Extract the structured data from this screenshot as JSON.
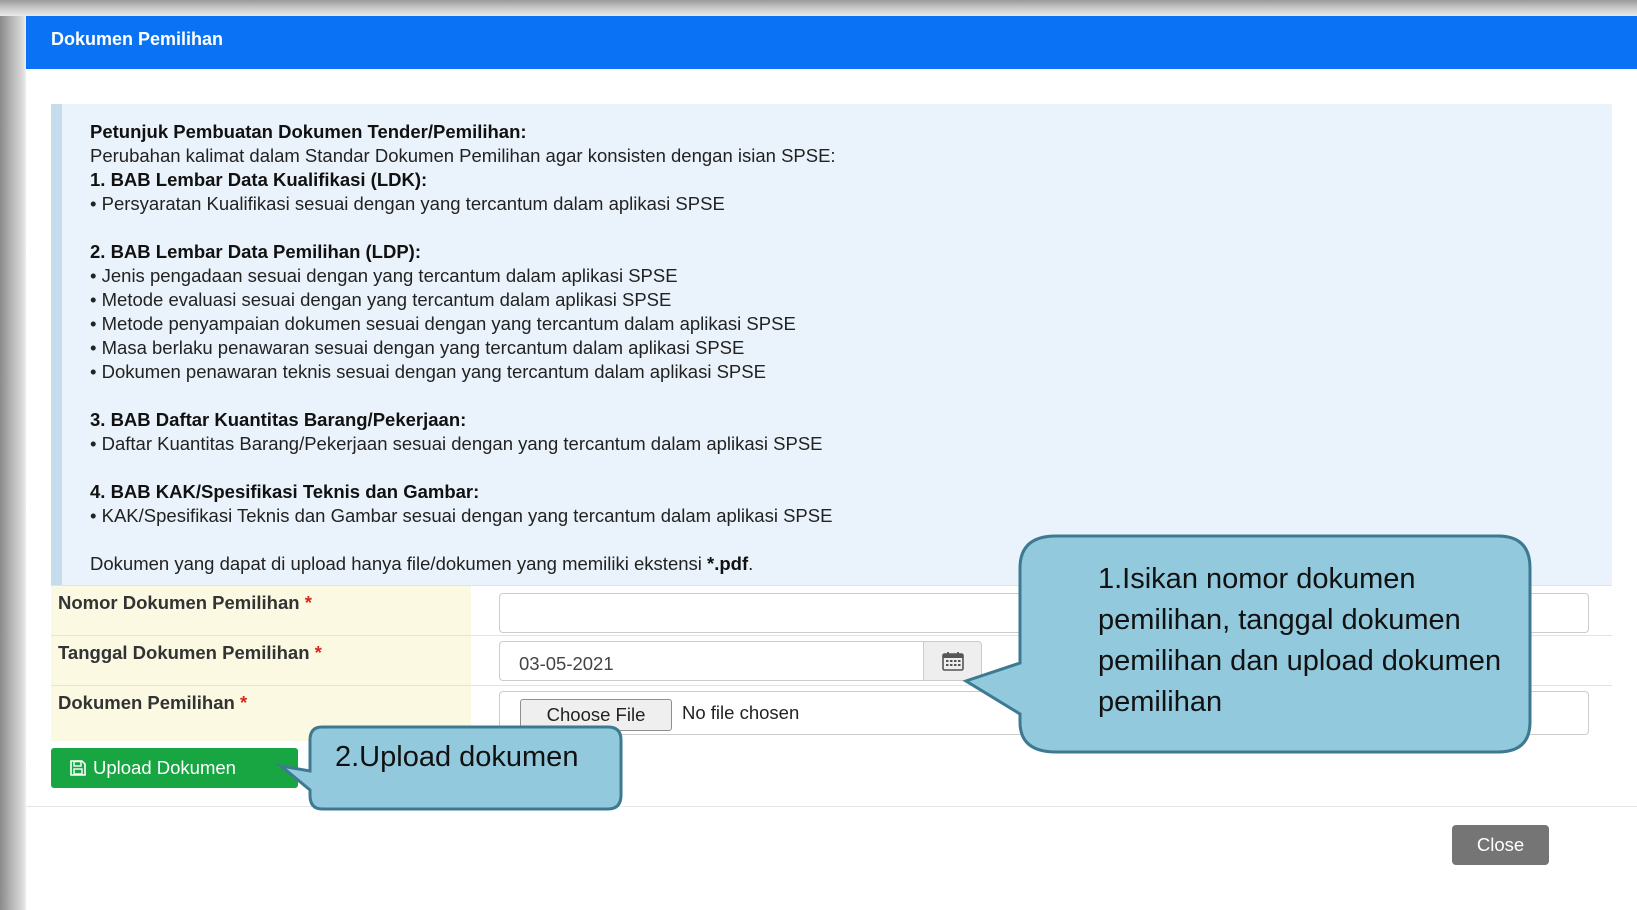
{
  "dialog": {
    "title": "Dokumen Pemilihan"
  },
  "instructions": {
    "heading": "Petunjuk Pembuatan Dokumen Tender/Pemilihan:",
    "intro": "Perubahan kalimat dalam Standar Dokumen Pemilihan agar konsisten dengan isian SPSE:",
    "sections": [
      {
        "title": "1. BAB Lembar Data Kualifikasi (LDK):",
        "items": [
          "• Persyaratan Kualifikasi sesuai dengan yang tercantum dalam aplikasi SPSE"
        ]
      },
      {
        "title": "2. BAB Lembar Data Pemilihan (LDP):",
        "items": [
          "• Jenis pengadaan sesuai dengan yang tercantum dalam aplikasi SPSE",
          "• Metode evaluasi sesuai dengan yang tercantum dalam aplikasi SPSE",
          "• Metode penyampaian dokumen sesuai dengan yang tercantum dalam aplikasi SPSE",
          "• Masa berlaku penawaran sesuai dengan yang tercantum dalam aplikasi SPSE",
          "• Dokumen penawaran teknis sesuai dengan yang tercantum dalam aplikasi SPSE"
        ]
      },
      {
        "title": "3. BAB Daftar Kuantitas Barang/Pekerjaan:",
        "items": [
          "• Daftar Kuantitas Barang/Pekerjaan sesuai dengan yang tercantum dalam aplikasi SPSE"
        ]
      },
      {
        "title": "4. BAB KAK/Spesifikasi Teknis dan Gambar:",
        "items": [
          "• KAK/Spesifikasi Teknis dan Gambar sesuai dengan yang tercantum dalam aplikasi SPSE"
        ]
      }
    ],
    "note_prefix": "Dokumen yang dapat di upload hanya file/dokumen yang memiliki ekstensi ",
    "note_ext": "*.pdf",
    "note_suffix": "."
  },
  "form": {
    "nomor": {
      "label": "Nomor Dokumen Pemilihan",
      "required_mark": "*",
      "value": ""
    },
    "tanggal": {
      "label": "Tanggal Dokumen Pemilihan",
      "required_mark": "*",
      "value": "03-05-2021",
      "icon": "calendar-icon"
    },
    "dokumen": {
      "label": "Dokumen Pemilihan",
      "required_mark": "*",
      "button_label": "Choose File",
      "status": "No file chosen"
    }
  },
  "actions": {
    "upload_label": "Upload Dokumen",
    "upload_icon": "save-icon",
    "close_label": "Close"
  },
  "callouts": {
    "step1": "1.Isikan nomor dokumen pemilihan, tanggal dokumen pemilihan dan upload dokumen pemilihan",
    "step2": "2.Upload dokumen"
  },
  "colors": {
    "header": "#0a72f5",
    "upload_button": "#18a642",
    "close_button": "#757575",
    "callout_fill": "#92c9dc",
    "callout_border": "#3d7a92",
    "required": "#d9261c"
  }
}
